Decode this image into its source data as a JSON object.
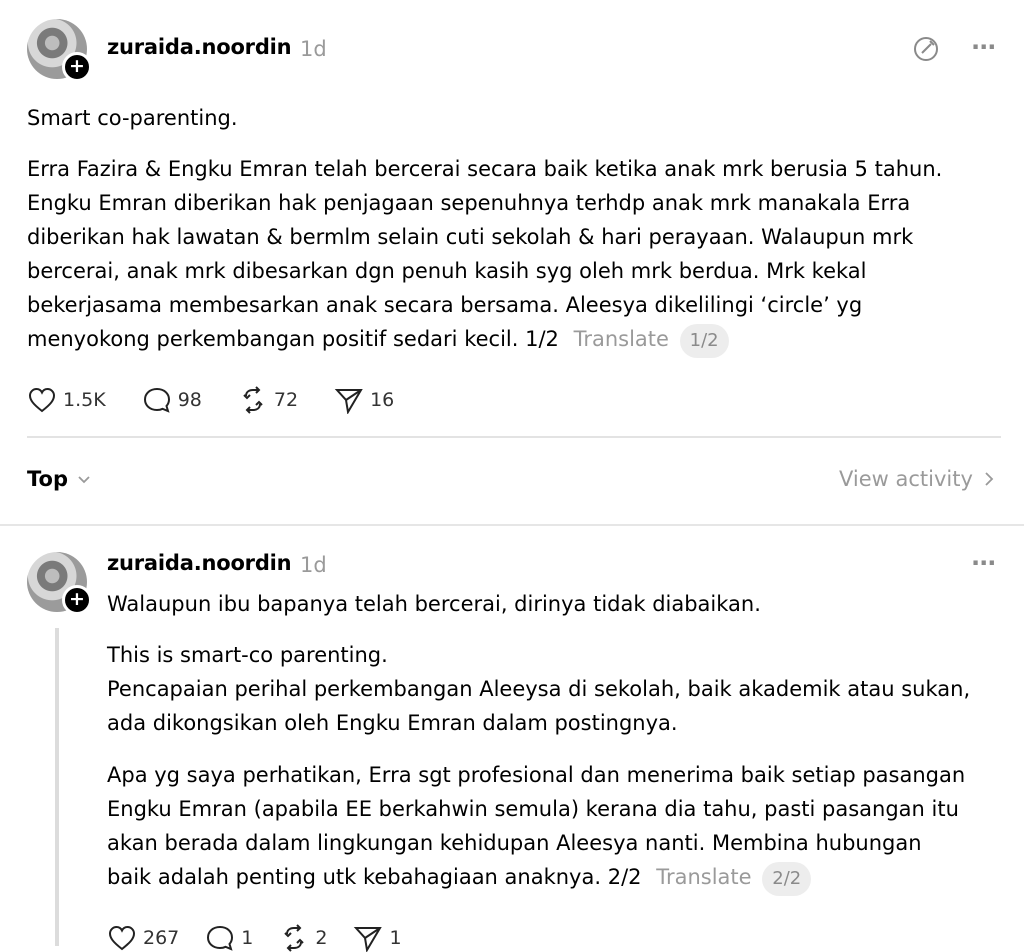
{
  "post": {
    "username": "zuraida.noordin",
    "time": "1d",
    "title_line": "Smart co-parenting.",
    "body_lines": [
      "Erra Fazira & Engku Emran telah bercerai secara baik ketika anak mrk berusia 5 tahun.",
      "Engku Emran diberikan hak penjagaan sepenuhnya terhdp anak mrk manakala Erra",
      "diberikan hak lawatan & bermlm selain cuti sekolah & hari perayaan. Walaupun mrk",
      "bercerai, anak mrk dibesarkan dgn penuh kasih syg oleh mrk berdua. Mrk kekal",
      "bekerjasama membesarkan anak secara bersama. Aleesya dikelilingi ‘circle’ yg",
      "menyokong perkembangan positif sedari kecil. 1/2"
    ],
    "translate_label": "Translate",
    "pager": "1/2",
    "likes": "1.5K",
    "replies": "98",
    "reposts": "72",
    "shares": "16"
  },
  "sort": {
    "label": "Top"
  },
  "activity": {
    "label": "View activity"
  },
  "reply": {
    "username": "zuraida.noordin",
    "time": "1d",
    "first_line": "Walaupun ibu bapanya telah bercerai, dirinya tidak diabaikan.",
    "para1": [
      "This is smart-co parenting.",
      "Pencapaian perihal perkembangan Aleeysa di sekolah, baik akademik atau sukan,",
      "ada dikongsikan oleh Engku Emran dalam postingnya."
    ],
    "para2": [
      "Apa yg saya perhatikan, Erra sgt profesional dan menerima baik setiap pasangan",
      "Engku Emran (apabila EE berkahwin semula) kerana dia tahu, pasti pasangan itu",
      "akan berada dalam lingkungan kehidupan Aleesya nanti. Membina hubungan",
      "baik adalah penting utk kebahagiaan anaknya. 2/2"
    ],
    "translate_label": "Translate",
    "pager": "2/2",
    "likes": "267",
    "replies": "1",
    "reposts": "2",
    "shares": "1"
  },
  "icons": {
    "plus": "+",
    "edit": "edit-circle-icon",
    "more": "···"
  }
}
